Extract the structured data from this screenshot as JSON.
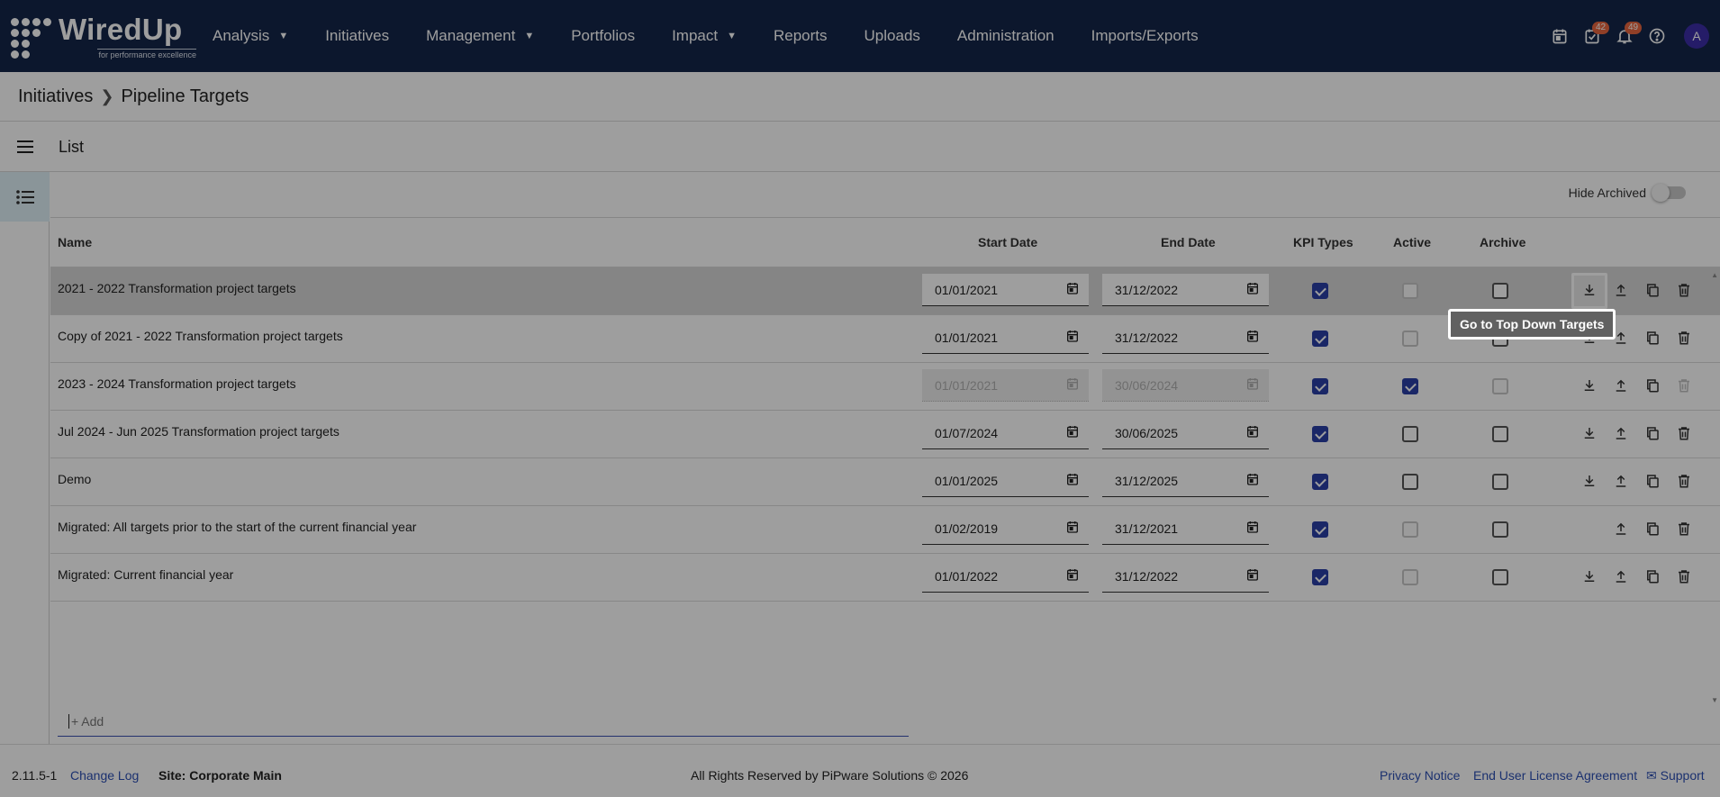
{
  "nav": {
    "logo_text": "WiredUp",
    "logo_tagline": "for performance excellence",
    "items": [
      {
        "label": "Analysis",
        "dropdown": true
      },
      {
        "label": "Initiatives",
        "dropdown": false
      },
      {
        "label": "Management",
        "dropdown": true
      },
      {
        "label": "Portfolios",
        "dropdown": false
      },
      {
        "label": "Impact",
        "dropdown": true
      },
      {
        "label": "Reports",
        "dropdown": false
      },
      {
        "label": "Uploads",
        "dropdown": false
      },
      {
        "label": "Administration",
        "dropdown": false
      },
      {
        "label": "Imports/Exports",
        "dropdown": false
      }
    ],
    "tasks_badge": "42",
    "notifications_badge": "49",
    "avatar_initial": "A",
    "avatar_color": "#3d2ea8",
    "bar_color": "#14264a"
  },
  "breadcrumb": {
    "parent": "Initiatives",
    "current": "Pipeline Targets"
  },
  "listbar": {
    "title": "List"
  },
  "filters": {
    "hide_archived_label": "Hide Archived",
    "hide_archived_on": false
  },
  "table": {
    "headers": {
      "name": "Name",
      "start_date": "Start Date",
      "end_date": "End Date",
      "kpi_types": "KPI Types",
      "active": "Active",
      "archive": "Archive"
    },
    "rows": [
      {
        "name": "2021 - 2022 Transformation project targets",
        "start": "01/01/2021",
        "end": "31/12/2022",
        "kpi": true,
        "active": false,
        "archive": false,
        "dates_disabled": false,
        "active_disabled": true,
        "archive_disabled": false,
        "has_top_down": true,
        "delete_disabled": false
      },
      {
        "name": "Copy of 2021 - 2022 Transformation project targets",
        "start": "01/01/2021",
        "end": "31/12/2022",
        "kpi": true,
        "active": false,
        "archive": false,
        "dates_disabled": false,
        "active_disabled": true,
        "archive_disabled": false,
        "has_top_down": true,
        "delete_disabled": false
      },
      {
        "name": "2023 - 2024 Transformation project targets",
        "start": "01/01/2021",
        "end": "30/06/2024",
        "kpi": true,
        "active": true,
        "archive": false,
        "dates_disabled": true,
        "active_disabled": false,
        "archive_disabled": true,
        "has_top_down": true,
        "delete_disabled": true
      },
      {
        "name": "Jul 2024 - Jun 2025 Transformation project targets",
        "start": "01/07/2024",
        "end": "30/06/2025",
        "kpi": true,
        "active": false,
        "archive": false,
        "dates_disabled": false,
        "active_disabled": false,
        "archive_disabled": false,
        "has_top_down": true,
        "delete_disabled": false
      },
      {
        "name": "Demo",
        "start": "01/01/2025",
        "end": "31/12/2025",
        "kpi": true,
        "active": false,
        "archive": false,
        "dates_disabled": false,
        "active_disabled": false,
        "archive_disabled": false,
        "has_top_down": true,
        "delete_disabled": false
      },
      {
        "name": "Migrated: All targets prior to the start of the current financial year",
        "start": "01/02/2019",
        "end": "31/12/2021",
        "kpi": true,
        "active": false,
        "archive": false,
        "dates_disabled": false,
        "active_disabled": true,
        "archive_disabled": false,
        "has_top_down": false,
        "delete_disabled": false
      },
      {
        "name": "Migrated: Current financial year",
        "start": "01/01/2022",
        "end": "31/12/2022",
        "kpi": true,
        "active": false,
        "archive": false,
        "dates_disabled": false,
        "active_disabled": true,
        "archive_disabled": false,
        "has_top_down": true,
        "delete_disabled": false
      }
    ]
  },
  "tooltip": {
    "text": "Go to Top Down Targets"
  },
  "add_row": {
    "placeholder": "+ Add"
  },
  "footer": {
    "version": "2.11.5-1",
    "change_log": "Change Log",
    "site": "Site: Corporate Main",
    "copyright": "All Rights Reserved by PiPware Solutions © 2026",
    "privacy": "Privacy Notice",
    "eula": "End User License Agreement",
    "support": "Support"
  },
  "icons": {
    "top_down": "arrow-down-to-line-icon",
    "upload": "arrow-up-from-line-icon",
    "copy": "copy-icon",
    "delete": "trash-icon",
    "calendar": "calendar-icon"
  },
  "colors": {
    "checkbox_checked": "#2b3fa6",
    "link": "#2d4fb4",
    "badge": "#e9663f"
  }
}
